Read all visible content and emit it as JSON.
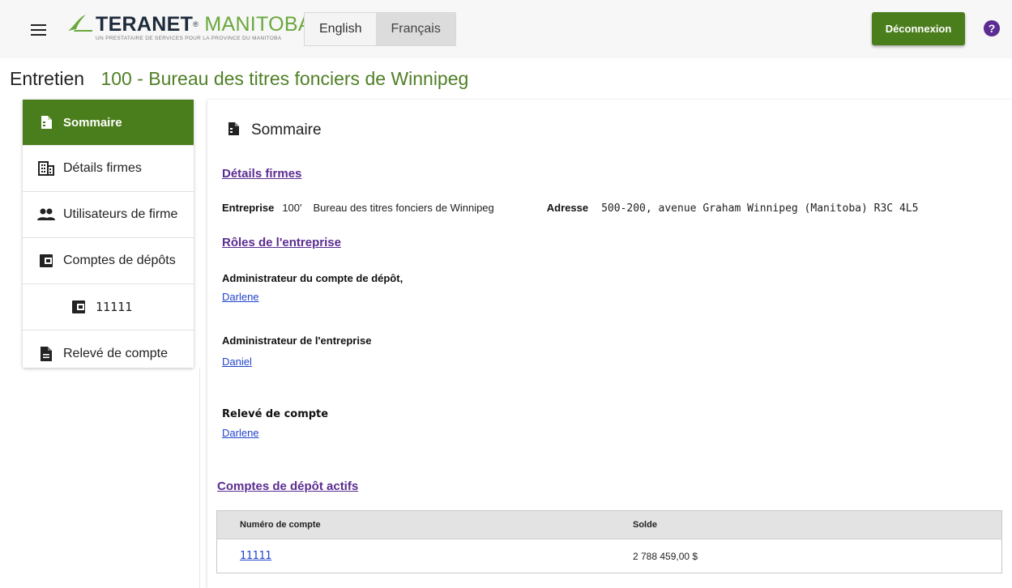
{
  "header": {
    "logo_brand": "TERANET",
    "logo_reg": "®",
    "logo_region": "MANITOBA",
    "logo_tagline": "UN PRESTATAIRE DE SERVICES POUR LA PROVINCE DU MANITOBA",
    "lang_english": "English",
    "lang_french": "Français",
    "logout_label": "Déconnexion",
    "help_glyph": "?"
  },
  "page": {
    "title_label": "Entretien",
    "title_entity": "100  - Bureau des titres fonciers de Winnipeg"
  },
  "sidebar": {
    "items": [
      {
        "label": "Sommaire",
        "icon": "summary-icon"
      },
      {
        "label": "Détails firmes",
        "icon": "building-icon"
      },
      {
        "label": "Utilisateurs de firme",
        "icon": "users-icon"
      },
      {
        "label": "Comptes de dépôts",
        "icon": "wallet-icon"
      },
      {
        "label": "11111",
        "icon": "wallet-icon"
      },
      {
        "label": "Relevé de compte",
        "icon": "document-icon"
      }
    ]
  },
  "main": {
    "title": "Sommaire",
    "firm_section": "Détails firmes",
    "company_label": "Entreprise",
    "company_id": "100'",
    "company_name": "Bureau des titres fonciers de Winnipeg",
    "address_label": "Adresse",
    "address_value": "500-200, avenue Graham Winnipeg (Manitoba) R3C 4L5",
    "roles_section": "Rôles de l'entreprise",
    "roles": [
      {
        "role": "Administrateur du compte de dépôt,",
        "name": "Darlene"
      },
      {
        "role": "Administrateur de l'entreprise",
        "name": "Daniel"
      },
      {
        "role": "Relevé de compte",
        "name": "Darlene"
      }
    ],
    "accounts_section": "Comptes de dépôt actifs",
    "table": {
      "headers": [
        "Numéro de compte",
        "Solde"
      ],
      "rows": [
        {
          "account": "11111",
          "balance": "2 788 459,00 $"
        }
      ]
    }
  },
  "colors": {
    "brand_green": "#4a7d1b",
    "title_green": "#4f7f26",
    "purple": "#5b2c91",
    "link_blue": "#2244cc"
  }
}
